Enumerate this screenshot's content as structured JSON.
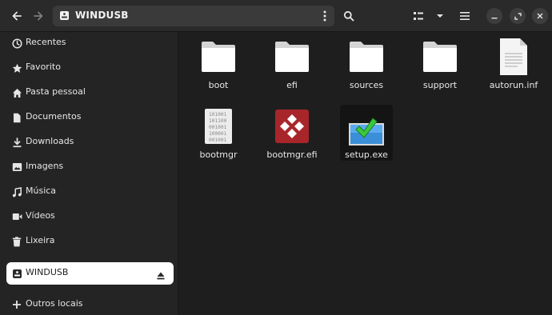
{
  "window": {
    "location": "WINDUSB"
  },
  "headerbar": {
    "back_icon": "arrow-left-icon",
    "forward_icon": "arrow-right-icon",
    "path_icon": "drive-icon",
    "path_menu_icon": "vertical-dots-icon",
    "search_icon": "search-icon",
    "view_icon": "list-view-icon",
    "view_dropdown_icon": "chevron-down-icon",
    "menu_icon": "hamburger-icon",
    "minimize_icon": "minimize-icon",
    "maximize_icon": "maximize-icon",
    "close_icon": "close-icon"
  },
  "sidebar": {
    "items": [
      {
        "label": "Recentes",
        "icon": "clock-icon"
      },
      {
        "label": "Favorito",
        "icon": "star-icon"
      },
      {
        "label": "Pasta pessoal",
        "icon": "home-icon"
      },
      {
        "label": "Documentos",
        "icon": "document-icon"
      },
      {
        "label": "Downloads",
        "icon": "download-icon"
      },
      {
        "label": "Imagens",
        "icon": "image-icon"
      },
      {
        "label": "Música",
        "icon": "music-icon"
      },
      {
        "label": "Vídeos",
        "icon": "video-icon"
      },
      {
        "label": "Lixeira",
        "icon": "trash-icon"
      }
    ],
    "devices": [
      {
        "label": "WINDUSB",
        "icon": "drive-icon",
        "eject_icon": "eject-icon",
        "active": true
      }
    ],
    "other": {
      "label": "Outros locais",
      "icon": "plus-icon"
    }
  },
  "files": [
    {
      "name": "boot",
      "type": "folder"
    },
    {
      "name": "efi",
      "type": "folder"
    },
    {
      "name": "sources",
      "type": "folder"
    },
    {
      "name": "support",
      "type": "folder"
    },
    {
      "name": "autorun.inf",
      "type": "text"
    },
    {
      "name": "bootmgr",
      "type": "binary"
    },
    {
      "name": "bootmgr.efi",
      "type": "efi"
    },
    {
      "name": "setup.exe",
      "type": "exe",
      "selected": true
    }
  ],
  "colors": {
    "background": "#1e1e1e",
    "sidebar": "#242424",
    "headerbar": "#2a2a2a",
    "active_item": "#ffffff",
    "efi_red": "#a8262a",
    "setup_blue": "#3a8fd8",
    "setup_green": "#3cc83c"
  }
}
